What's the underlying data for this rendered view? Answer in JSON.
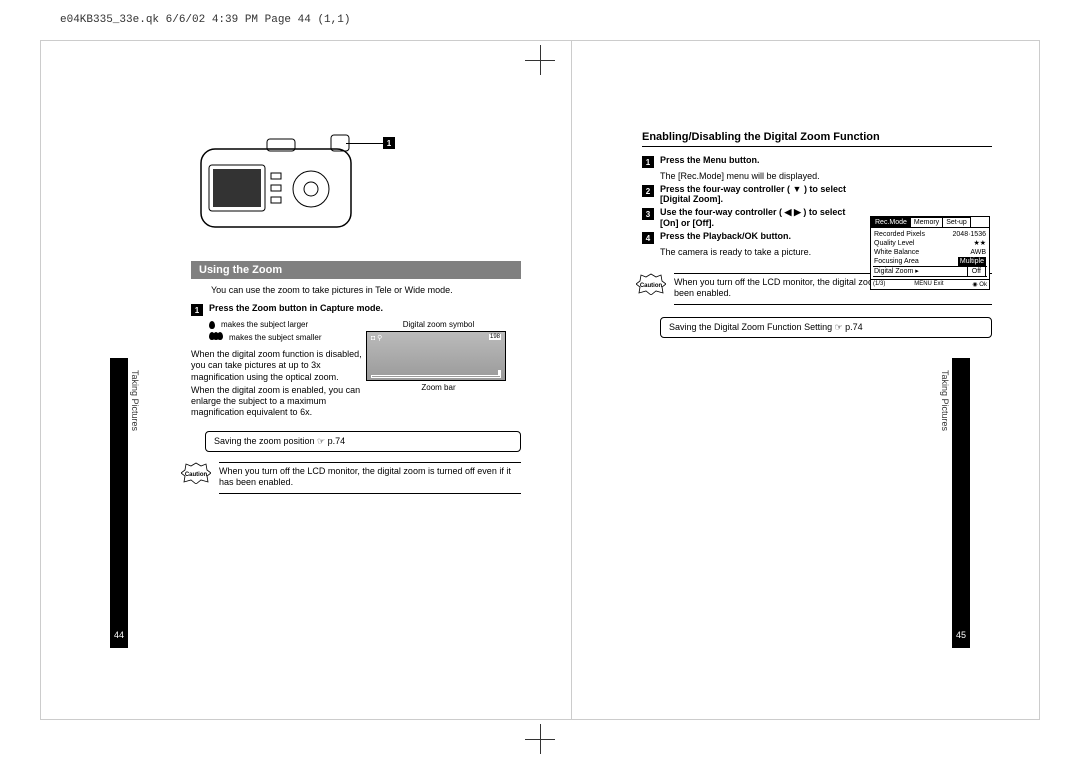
{
  "header": "e04KB335_33e.qk  6/6/02 4:39 PM  Page 44 (1,1)",
  "side_label": "Taking Pictures",
  "page_left_num": "44",
  "page_right_num": "45",
  "left": {
    "callout1": "1",
    "section_title": "Using the Zoom",
    "intro": "You can use the zoom to take pictures in Tele or Wide mode.",
    "step1": "Press the Zoom button in Capture mode.",
    "icon_larger": "makes the subject larger",
    "icon_smaller": "makes the subject smaller",
    "para1": "When the digital zoom function is disabled, you can take pictures at up to 3x magnification using the optical zoom.",
    "para2": "When the digital zoom is enabled, you can enlarge the subject to a maximum magnification equivalent to 6x.",
    "lcd_label_top": "Digital zoom symbol",
    "lcd_top_left": "◘ ⚲",
    "lcd_top_right": "198",
    "lcd_label_bottom": "Zoom bar",
    "ref": "Saving the zoom position ☞ p.74",
    "caution": "When you turn off the LCD monitor, the digital zoom is turned off even if it has been enabled.",
    "caution_label": "Caution"
  },
  "right": {
    "section_title": "Enabling/Disabling the Digital Zoom Function",
    "s1": "Press the Menu button.",
    "s1_sub": "The [Rec.Mode] menu will be displayed.",
    "s2": "Press the four-way controller ( ▼ ) to select [Digital Zoom].",
    "s3": "Use the four-way controller ( ◀ ▶ ) to select [On] or [Off].",
    "s4": "Press the Playback/OK button.",
    "s4_sub": "The camera is ready to take a picture.",
    "caution": "When you turn off the LCD monitor, the digital zoom is turned off even if it has been enabled.",
    "ref": "Saving the Digital Zoom Function Setting ☞ p.74",
    "menu": {
      "tab1": "Rec.Mode",
      "tab2": "Memory",
      "tab3": "Set-up",
      "r1a": "Recorded Pixels",
      "r1b": "2048·1536",
      "r2a": "Quality Level",
      "r2b": "★★",
      "r3a": "White Balance",
      "r3b": "AWB",
      "r4a": "Focusing Area",
      "r4b": "Multiple",
      "r5a": "Digital Zoom ▸",
      "r5b": "Off",
      "f1": "(1/3)",
      "f2": "MENU Exit",
      "f3": "◉ Ok"
    }
  }
}
